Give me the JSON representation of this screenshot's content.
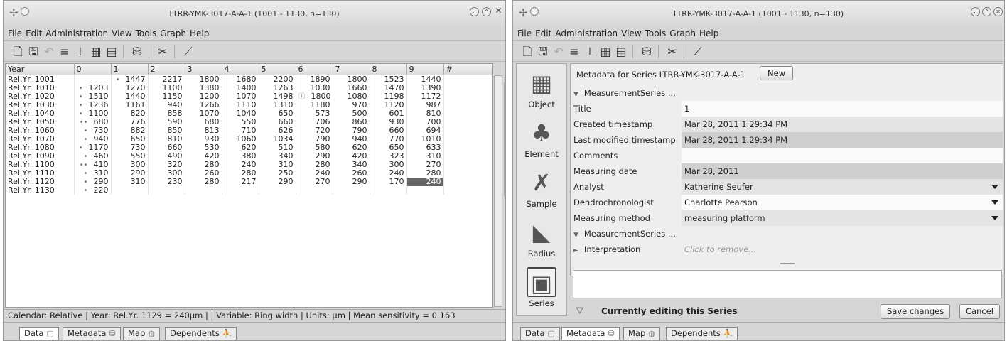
{
  "left_window": {
    "title": "LTRR-YMK-3017-A-A-1 (1001 - 1130, n=130)",
    "menu": [
      "File",
      "Edit",
      "Administration",
      "View",
      "Tools",
      "Graph",
      "Help"
    ],
    "table": {
      "headers": [
        "Year",
        "0",
        "1",
        "2",
        "3",
        "4",
        "5",
        "6",
        "7",
        "8",
        "9",
        "#"
      ],
      "rows": [
        {
          "year": "Rel.Yr. 1001",
          "cells": [
            "",
            "1447",
            "2217",
            "1800",
            "1680",
            "2200",
            "1890",
            "1800",
            "1523",
            "1440"
          ],
          "marks": [
            "",
            "•",
            "",
            "",
            "",
            "",
            "",
            "",
            "",
            ""
          ]
        },
        {
          "year": "Rel.Yr. 1010",
          "cells": [
            "1203",
            "1270",
            "1100",
            "1380",
            "1400",
            "1263",
            "1030",
            "1660",
            "1470",
            "1390"
          ],
          "marks": [
            "•",
            "",
            "",
            "",
            "",
            "",
            "",
            "",
            "",
            ""
          ]
        },
        {
          "year": "Rel.Yr. 1020",
          "cells": [
            "1510",
            "1440",
            "1150",
            "1200",
            "1070",
            "1498",
            "1800",
            "1080",
            "1198",
            "1172"
          ],
          "marks": [
            "•",
            "",
            "",
            "",
            "",
            "",
            "ⓘ",
            "",
            "",
            ""
          ]
        },
        {
          "year": "Rel.Yr. 1030",
          "cells": [
            "1236",
            "1161",
            "940",
            "1266",
            "1110",
            "1310",
            "1180",
            "970",
            "1120",
            "987"
          ],
          "marks": [
            "•",
            "",
            "",
            "",
            "",
            "",
            "",
            "",
            "",
            ""
          ]
        },
        {
          "year": "Rel.Yr. 1040",
          "cells": [
            "1100",
            "820",
            "858",
            "1070",
            "1040",
            "650",
            "573",
            "500",
            "601",
            "810"
          ],
          "marks": [
            "•",
            "",
            "",
            "",
            "",
            "",
            "",
            "",
            "",
            ""
          ]
        },
        {
          "year": "Rel.Yr. 1050",
          "cells": [
            "680",
            "776",
            "590",
            "680",
            "550",
            "660",
            "706",
            "860",
            "930",
            "700"
          ],
          "marks": [
            "••",
            "",
            "",
            "",
            "",
            "",
            "",
            "",
            "",
            ""
          ]
        },
        {
          "year": "Rel.Yr. 1060",
          "cells": [
            "730",
            "882",
            "850",
            "813",
            "710",
            "626",
            "720",
            "790",
            "660",
            "694"
          ],
          "marks": [
            "•",
            "",
            "",
            "",
            "",
            "",
            "",
            "",
            "",
            ""
          ]
        },
        {
          "year": "Rel.Yr. 1070",
          "cells": [
            "940",
            "650",
            "810",
            "930",
            "1060",
            "1034",
            "790",
            "940",
            "770",
            "1010"
          ],
          "marks": [
            "•",
            "",
            "",
            "",
            "",
            "",
            "",
            "",
            "",
            ""
          ]
        },
        {
          "year": "Rel.Yr. 1080",
          "cells": [
            "1170",
            "730",
            "660",
            "530",
            "620",
            "510",
            "580",
            "620",
            "650",
            "633"
          ],
          "marks": [
            "•",
            "",
            "",
            "",
            "",
            "",
            "",
            "",
            "",
            ""
          ]
        },
        {
          "year": "Rel.Yr. 1090",
          "cells": [
            "460",
            "550",
            "490",
            "420",
            "380",
            "340",
            "290",
            "420",
            "323",
            "310"
          ],
          "marks": [
            "•",
            "",
            "",
            "",
            "",
            "",
            "",
            "",
            "",
            ""
          ]
        },
        {
          "year": "Rel.Yr. 1100",
          "cells": [
            "410",
            "300",
            "320",
            "280",
            "240",
            "310",
            "280",
            "340",
            "300",
            "270"
          ],
          "marks": [
            "••",
            "",
            "",
            "",
            "",
            "",
            "",
            "",
            "",
            ""
          ]
        },
        {
          "year": "Rel.Yr. 1110",
          "cells": [
            "310",
            "290",
            "300",
            "260",
            "280",
            "250",
            "240",
            "260",
            "240",
            "280"
          ],
          "marks": [
            "•",
            "",
            "",
            "",
            "",
            "",
            "",
            "",
            "",
            ""
          ]
        },
        {
          "year": "Rel.Yr. 1120",
          "cells": [
            "290",
            "310",
            "230",
            "280",
            "217",
            "290",
            "270",
            "290",
            "170",
            "240"
          ],
          "marks": [
            "•",
            "",
            "",
            "",
            "",
            "",
            "",
            "",
            "",
            ""
          ]
        },
        {
          "year": "Rel.Yr. 1130",
          "cells": [
            "220",
            "",
            "",
            "",
            "",
            "",
            "",
            "",
            "",
            ""
          ],
          "marks": [
            "•",
            "",
            "",
            "",
            "",
            "",
            "",
            "",
            "",
            ""
          ]
        }
      ]
    },
    "status": "Calendar: Relative  |  Year: Rel.Yr. 1129 = 240µm  |          |  Variable: Ring width  |  Units: µm  |  Mean sensitivity = 0.163",
    "tabs": [
      "Data",
      "Metadata",
      "Map",
      "Dependents"
    ]
  },
  "right_window": {
    "title": "LTRR-YMK-3017-A-A-1 (1001 - 1130, n=130)",
    "menu": [
      "File",
      "Edit",
      "Administration",
      "View",
      "Tools",
      "Graph",
      "Help"
    ],
    "sidebar": [
      "Object",
      "Element",
      "Sample",
      "Radius",
      "Series"
    ],
    "metadata_heading": "Metadata for Series LTRR-YMK-3017-A-A-1",
    "new_label": "New",
    "group1": "MeasurementSeries ...",
    "fields": [
      {
        "key": "Title",
        "value": "1"
      },
      {
        "key": "Created timestamp",
        "value": "Mar 28, 2011 1:29:34 PM"
      },
      {
        "key": "Last modified timestamp",
        "value": "Mar 28, 2011 1:29:34 PM"
      },
      {
        "key": "Comments",
        "value": ""
      },
      {
        "key": "Measuring date",
        "value": "Mar 28, 2011"
      },
      {
        "key": "Analyst",
        "value": "Katherine Seufer"
      },
      {
        "key": "Dendrochronologist",
        "value": "Charlotte Pearson"
      },
      {
        "key": "Measuring method",
        "value": "measuring platform"
      }
    ],
    "group2": "MeasurementSeries ...",
    "interpretation": "Interpretation",
    "remove_hint": "Click to remove...",
    "editing": "Currently editing this Series",
    "save_label": "Save changes",
    "cancel_label": "Cancel",
    "tabs": [
      "Data",
      "Metadata",
      "Map",
      "Dependents"
    ]
  }
}
